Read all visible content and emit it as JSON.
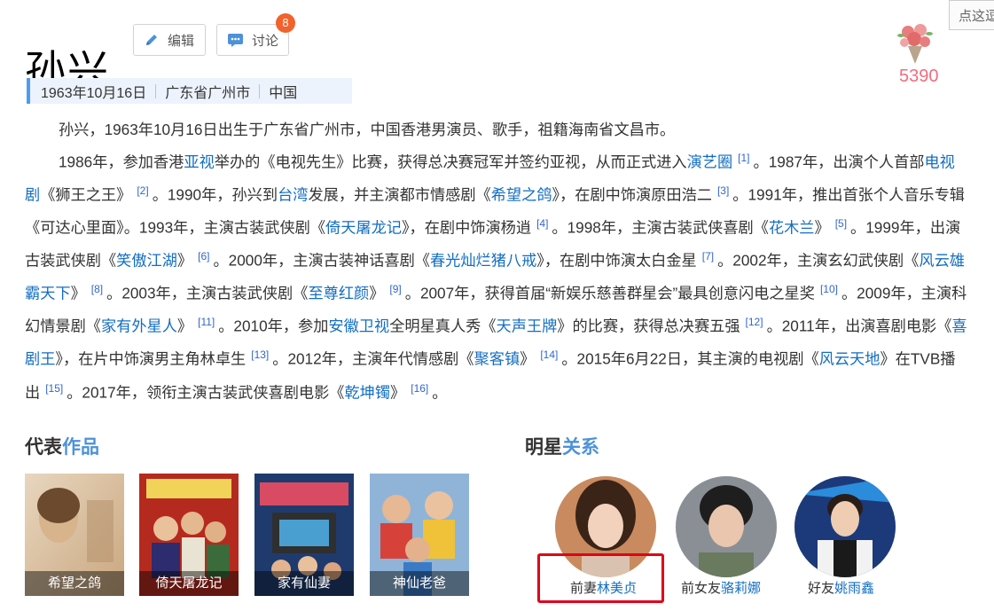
{
  "title": "孙兴",
  "buttons": {
    "edit": "编辑",
    "discuss": "讨论",
    "discuss_badge": "8"
  },
  "flower": {
    "count": "5390",
    "hint": "点这逗"
  },
  "basic_info": [
    "1963年10月16日",
    "广东省广州市",
    "中国"
  ],
  "summary_p1": "孙兴，1963年10月16日出生于广东省广州市，中国香港男演员、歌手，祖籍海南省文昌市。",
  "summary_p2": [
    {
      "t": "1986年，参加香港"
    },
    {
      "l": "亚视"
    },
    {
      "t": "举办的《电视先生》比赛，获得总决赛冠军并签约亚视，从而正式进入"
    },
    {
      "l": "演艺圈"
    },
    {
      "s": "[1]"
    },
    {
      "t": "。1987年，出演个人首部"
    },
    {
      "l": "电视剧"
    },
    {
      "t": "《狮王之王》"
    },
    {
      "s": "[2]"
    },
    {
      "t": "。1990年，孙兴到"
    },
    {
      "l": "台湾"
    },
    {
      "t": "发展，并主演都市情感剧《"
    },
    {
      "l": "希望之鸽"
    },
    {
      "t": "》，在剧中饰演原田浩二"
    },
    {
      "s": "[3]"
    },
    {
      "t": "。1991年，推出首张个人音乐专辑《可达心里面》。1993年，主演古装武侠剧《"
    },
    {
      "l": "倚天屠龙记"
    },
    {
      "t": "》，在剧中饰演杨逍"
    },
    {
      "s": "[4]"
    },
    {
      "t": "。1998年，主演古装武侠喜剧《"
    },
    {
      "l": "花木兰"
    },
    {
      "t": "》"
    },
    {
      "s": "[5]"
    },
    {
      "t": "。1999年，出演古装武侠剧《"
    },
    {
      "l": "笑傲江湖"
    },
    {
      "t": "》"
    },
    {
      "s": "[6]"
    },
    {
      "t": "。2000年，主演古装神话喜剧《"
    },
    {
      "l": "春光灿烂猪八戒"
    },
    {
      "t": "》，在剧中饰演太白金星"
    },
    {
      "s": "[7]"
    },
    {
      "t": "。2002年，主演玄幻武侠剧《"
    },
    {
      "l": "风云雄霸天下"
    },
    {
      "t": "》"
    },
    {
      "s": "[8]"
    },
    {
      "t": "。2003年，主演古装武侠剧《"
    },
    {
      "l": "至尊红颜"
    },
    {
      "t": "》"
    },
    {
      "s": "[9]"
    },
    {
      "t": "。2007年，获得首届“新娱乐慈善群星会”最具创意闪电之星奖"
    },
    {
      "s": "[10]"
    },
    {
      "t": "。2009年，主演科幻情景剧《"
    },
    {
      "l": "家有外星人"
    },
    {
      "t": "》"
    },
    {
      "s": "[11]"
    },
    {
      "t": "。2010年，参加"
    },
    {
      "l": "安徽卫视"
    },
    {
      "t": "全明星真人秀《"
    },
    {
      "l": "天声王牌"
    },
    {
      "t": "》的比赛，获得总决赛五强"
    },
    {
      "s": "[12]"
    },
    {
      "t": "。2011年，出演喜剧电影《"
    },
    {
      "l": "喜剧王"
    },
    {
      "t": "》，在片中饰演男主角林卓生"
    },
    {
      "s": "[13]"
    },
    {
      "t": "。2012年，主演年代情感剧《"
    },
    {
      "l": "聚客镇"
    },
    {
      "t": "》"
    },
    {
      "s": "[14]"
    },
    {
      "t": "。2015年6月22日，其主演的电视剧《"
    },
    {
      "l": "风云天地"
    },
    {
      "t": "》在TVB播出"
    },
    {
      "s": "[15]"
    },
    {
      "t": "。2017年，领衔主演古装武侠喜剧电影《"
    },
    {
      "l": "乾坤镯"
    },
    {
      "t": "》"
    },
    {
      "s": "[16]"
    },
    {
      "t": "。"
    }
  ],
  "works_section": {
    "prefix": "代表",
    "highlight": "作品"
  },
  "works": [
    "希望之鸽",
    "倚天屠龙记",
    "家有仙妻",
    "神仙老爸"
  ],
  "relations_section": {
    "prefix": "明星",
    "highlight": "关系"
  },
  "relations": [
    {
      "relation": "前妻",
      "name": "林美贞"
    },
    {
      "relation": "前女友",
      "name": "骆莉娜"
    },
    {
      "relation": "好友",
      "name": "姚雨鑫"
    }
  ],
  "colors": {
    "link": "#136ec2",
    "accent": "#4d92d8",
    "highlight_border": "#e0001a",
    "badge": "#f2622c"
  }
}
